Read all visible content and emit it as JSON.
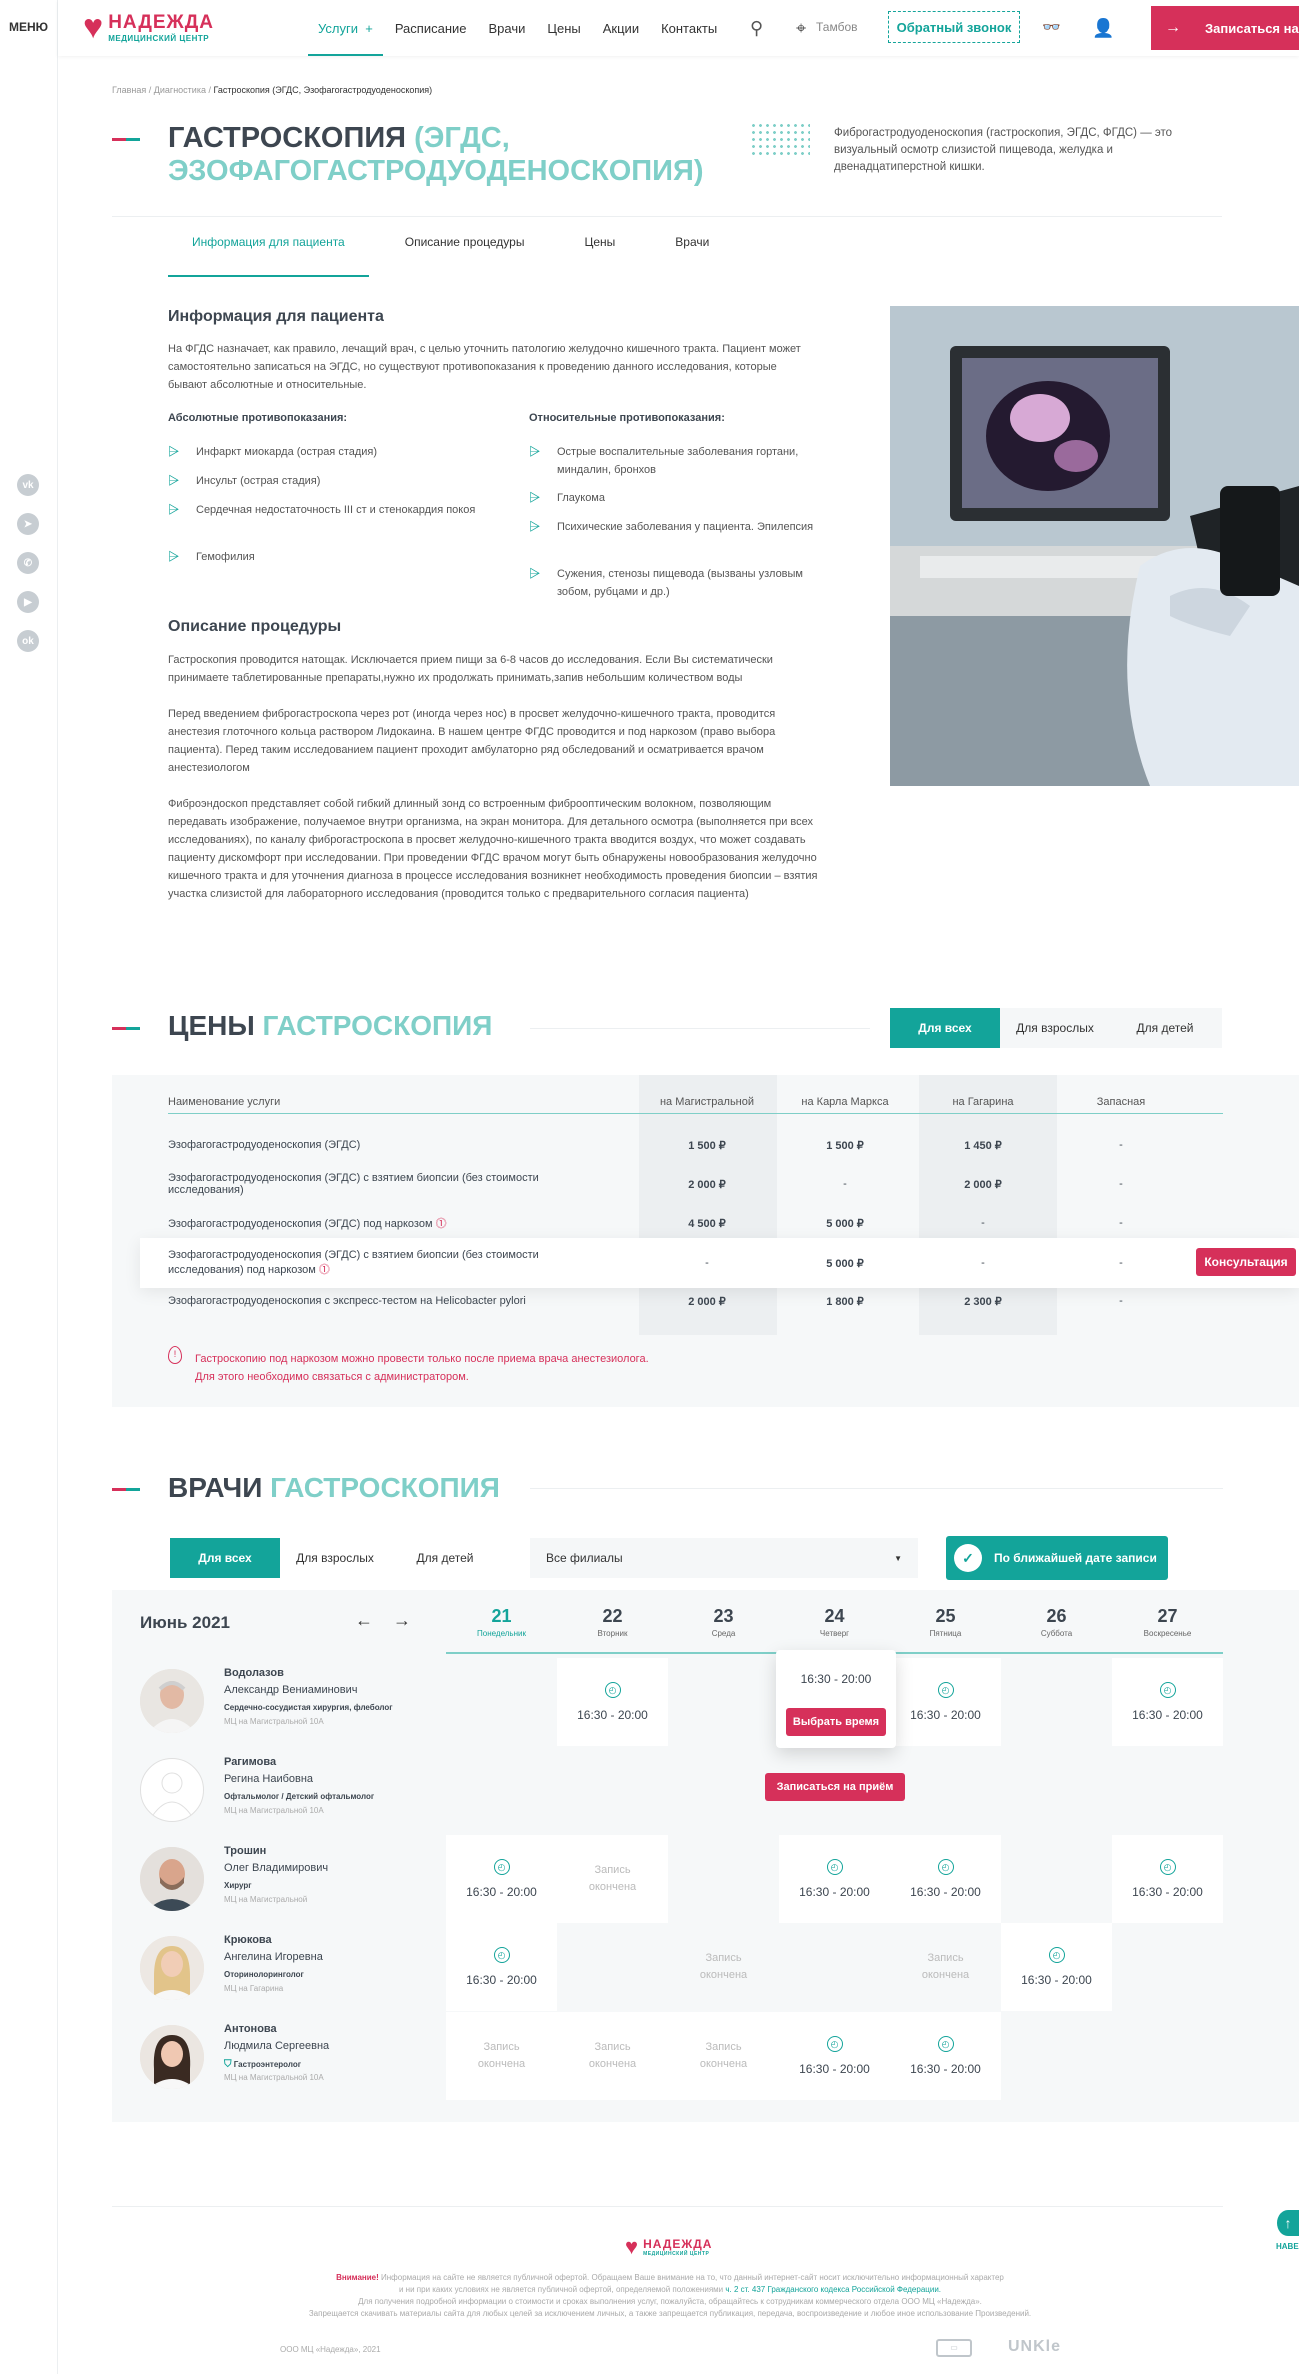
{
  "sidebar": {
    "menu_label": "МЕНЮ",
    "socials": [
      "vk-icon",
      "telegram-icon",
      "whatsapp-icon",
      "youtube-icon",
      "odnoklassniki-icon"
    ]
  },
  "header": {
    "logo_title": "НАДЕЖДА",
    "logo_sub": "МЕДИЦИНСКИЙ ЦЕНТР",
    "nav": [
      "Услуги",
      "Расписание",
      "Врачи",
      "Цены",
      "Акции",
      "Контакты"
    ],
    "city": "Тамбов",
    "callback": "Обратный звонок",
    "signup": "Записаться на приём"
  },
  "breadcrumb": {
    "items": [
      "Главная /",
      "Диагностика /"
    ],
    "current": "Гастроскопия (ЭГДС, Эзофагогастродуоденоскопия)"
  },
  "page": {
    "title_main": "ГАСТРОСКОПИЯ",
    "title_acc": "(ЭГДС, ЭЗОФАГОГАСТРОДУОДЕНОСКОПИЯ)",
    "intro": "Фиброгастродуоденоскопия (гастроскопия, ЭГДС, ФГДС) — это визуальный осмотр слизистой пищевода, желудка и двенадцатиперстной кишки."
  },
  "tabs": [
    "Информация для пациента",
    "Описание процедуры",
    "Цены",
    "Врачи"
  ],
  "info": {
    "heading": "Информация для пациента",
    "text": "На ФГДС назначает, как правило, лечащий врач, с целью уточнить патологию желудочно кишечного тракта. Пациент может самостоятельно записаться на ЭГДС, но существуют противопоказания к проведению данного исследования, которые бывают абсолютные и относительные.",
    "abs_title": "Абсолютные противопоказания:",
    "abs": [
      "Инфаркт миокарда (острая стадия)",
      "Инсульт (острая стадия)",
      "Сердечная недостаточность III ст и стенокардия покоя",
      "Гемофилия"
    ],
    "rel_title": "Относительные противопоказания:",
    "rel": [
      "Острые воспалительные заболевания гортани, миндалин, бронхов",
      "Глаукома",
      "Психические заболевания у пациента. Эпилепсия",
      "Сужения, стенозы пищевода (вызваны узловым зобом, рубцами и др.)"
    ]
  },
  "procedure": {
    "heading": "Описание процедуры",
    "p1": "Гастроскопия проводится натощак. Исключается прием пищи за 6-8 часов до исследования. Если Вы систематически принимаете таблетированные препараты,нужно их продолжать принимать,запив небольшим количеством воды",
    "p2": "Перед введением фиброгастроскопа через рот (иногда через нос) в просвет желудочно-кишечного тракта, проводится анестезия глоточного кольца раствором Лидокаина. В нашем центре ФГДС проводится и под наркозом (право выбора пациента). Перед таким исследованием пациент проходит амбулаторно ряд обследований и осматривается врачом анестезиологом",
    "p3": "Фиброэндоскоп представляет собой гибкий длинный зонд со встроенным фиброоптическим волокном, позволяющим передавать изображение, получаемое внутри организма, на экран монитора. Для детального осмотра (выполняется при всех исследованиях), по каналу фиброгастроскопа в просвет желудочно-кишечного тракта вводится воздух, что может создавать пациенту дискомфорт при исследовании. При проведении ФГДС врачом могут быть обнаружены новообразования желудочно кишечного тракта и для уточнения диагноза в процессе исследования возникнет необходимость проведения биопсии – взятия участка слизистой для лабораторного исследования (проводится только с предварительного согласия пациента)"
  },
  "prices": {
    "title_main": "ЦЕНЫ",
    "title_acc": "ГАСТРОСКОПИЯ",
    "filters": [
      "Для всех",
      "Для взрослых",
      "Для детей"
    ],
    "columns": [
      "Наименование услуги",
      "на Магистральной",
      "на Карла Маркса",
      "на Гагарина",
      "Запасная"
    ],
    "rows": [
      {
        "name": "Эзофагогастродуоденоскопия (ЭГДС)",
        "c": [
          "1 500 ₽",
          "1 500 ₽",
          "1 450 ₽",
          "-"
        ]
      },
      {
        "name": "Эзофагогастродуоденоскопия (ЭГДС) с взятием биопсии (без стоимости исследования)",
        "c": [
          "2 000 ₽",
          "-",
          "2 000 ₽",
          "-"
        ]
      },
      {
        "name": "Эзофагогастродуоденоскопия (ЭГДС) под наркозом",
        "c": [
          "4 500 ₽",
          "5 000 ₽",
          "-",
          "-"
        ]
      },
      {
        "name": "Эзофагогастродуоденоскопия (ЭГДС)  с взятием биопсии (без стоимости исследования) под наркозом",
        "c": [
          "-",
          "5 000 ₽",
          "-",
          "-"
        ]
      },
      {
        "name": "Эзофагогастродуоденоскопия с экспресс-тестом на Helicobacter pylori",
        "c": [
          "2 000 ₽",
          "1 800 ₽",
          "2 300 ₽",
          "-"
        ]
      }
    ],
    "consult": "Консультация",
    "note1": "Гастроскопию под наркозом можно провести только после приема врача анестезиолога.",
    "note2": "Для этого необходимо связаться с администратором."
  },
  "doctors": {
    "title_main": "ВРАЧИ",
    "title_acc": "ГАСТРОСКОПИЯ",
    "filters": [
      "Для всех",
      "Для взрослых",
      "Для детей"
    ],
    "branch": "Все филиалы",
    "nearest": "По ближайшей дате записи",
    "month": "Июнь 2021",
    "days": [
      {
        "n": "21",
        "w": "Понедельник"
      },
      {
        "n": "22",
        "w": "Вторник"
      },
      {
        "n": "23",
        "w": "Среда"
      },
      {
        "n": "24",
        "w": "Четверг"
      },
      {
        "n": "25",
        "w": "Пятница"
      },
      {
        "n": "26",
        "w": "Суббота"
      },
      {
        "n": "27",
        "w": "Воскресенье"
      }
    ],
    "time": "16:30 - 20:00",
    "closed": "Запись окончена",
    "choose": "Выбрать время",
    "signup": "Записаться на приём",
    "list": [
      {
        "last": "Водолазов",
        "first": "Александр Вениаминович",
        "spec": "Сердечно-сосудистая хирургия, флеболог",
        "addr": "МЦ на Магистральной 10А"
      },
      {
        "last": "Рагимова",
        "first": "Регина Наибовна",
        "spec": "Офтальмолог / Детский офтальмолог",
        "addr": "МЦ на Магистральной 10А"
      },
      {
        "last": "Трошин",
        "first": "Олег Владимирович",
        "spec": "Хирург",
        "addr": "МЦ на Магистральной"
      },
      {
        "last": "Крюкова",
        "first": "Ангелина Игоревна",
        "spec": "Оторинолоринголог",
        "addr": "МЦ на Гагарина"
      },
      {
        "last": "Антонова",
        "first": "Людмила Сергеевна",
        "spec": "Гастроэнтеролог",
        "addr": "МЦ на Магистральной 10А"
      }
    ]
  },
  "footer": {
    "warn": "Внимание!",
    "line1": "Информация на сайте не является публичной офертой. Обращаем Ваше внимание на то, что данный интернет-сайт носит исключительно информационный характер",
    "line2a": "и ни при каких условиях не является публичной офертой, определяемой положениями",
    "line2b": "ч. 2 ст. 437 Гражданского кодекса Российской Федерации.",
    "line3": "Для получения подробной информации о стоимости и сроках выполнения услуг, пожалуйста, обращайтесь к сотрудникам коммерческого отдела ООО МЦ «Надежда».",
    "line4": "Запрещается скачивать материалы сайта для любых целей за исключением личных, а также запрещается публикация, передача, воспроизведение и любое иное использование Произведений.",
    "copy": "ООО МЦ «Надежда», 2021",
    "dev": "UNKle",
    "up": "НАВЕ"
  }
}
